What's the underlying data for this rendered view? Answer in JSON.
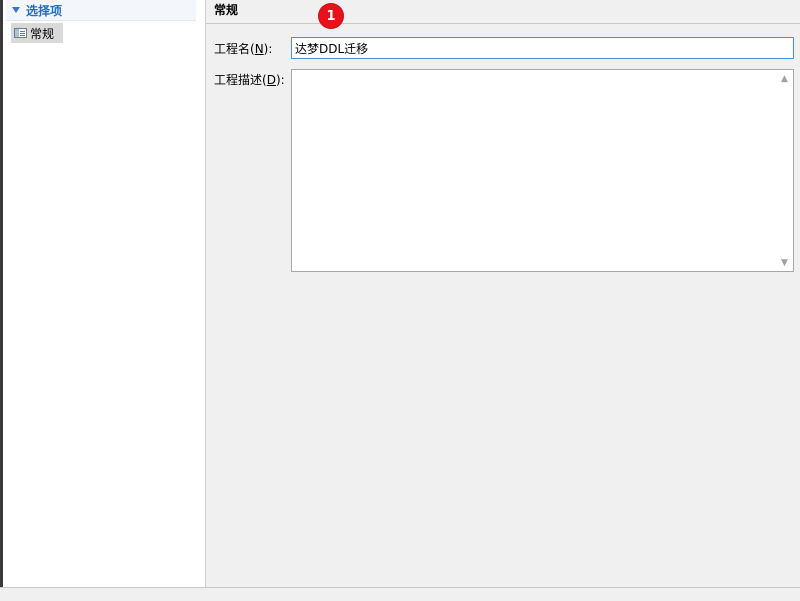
{
  "nav": {
    "header_label": "选择项",
    "items": [
      {
        "label": "常规",
        "icon": "page-icon",
        "selected": true
      }
    ]
  },
  "content": {
    "section_title": "常规",
    "badge": "1",
    "project_name": {
      "label_prefix": "工程名(",
      "mnemonic": "N",
      "label_suffix": "):",
      "value": "达梦DDL迁移"
    },
    "project_desc": {
      "label_prefix": "工程描述(",
      "mnemonic": "D",
      "label_suffix": "):",
      "value": ""
    }
  },
  "colors": {
    "accent": "#1f6fc5",
    "badge": "#e8121d",
    "input_focus_border": "#4a90d9"
  }
}
